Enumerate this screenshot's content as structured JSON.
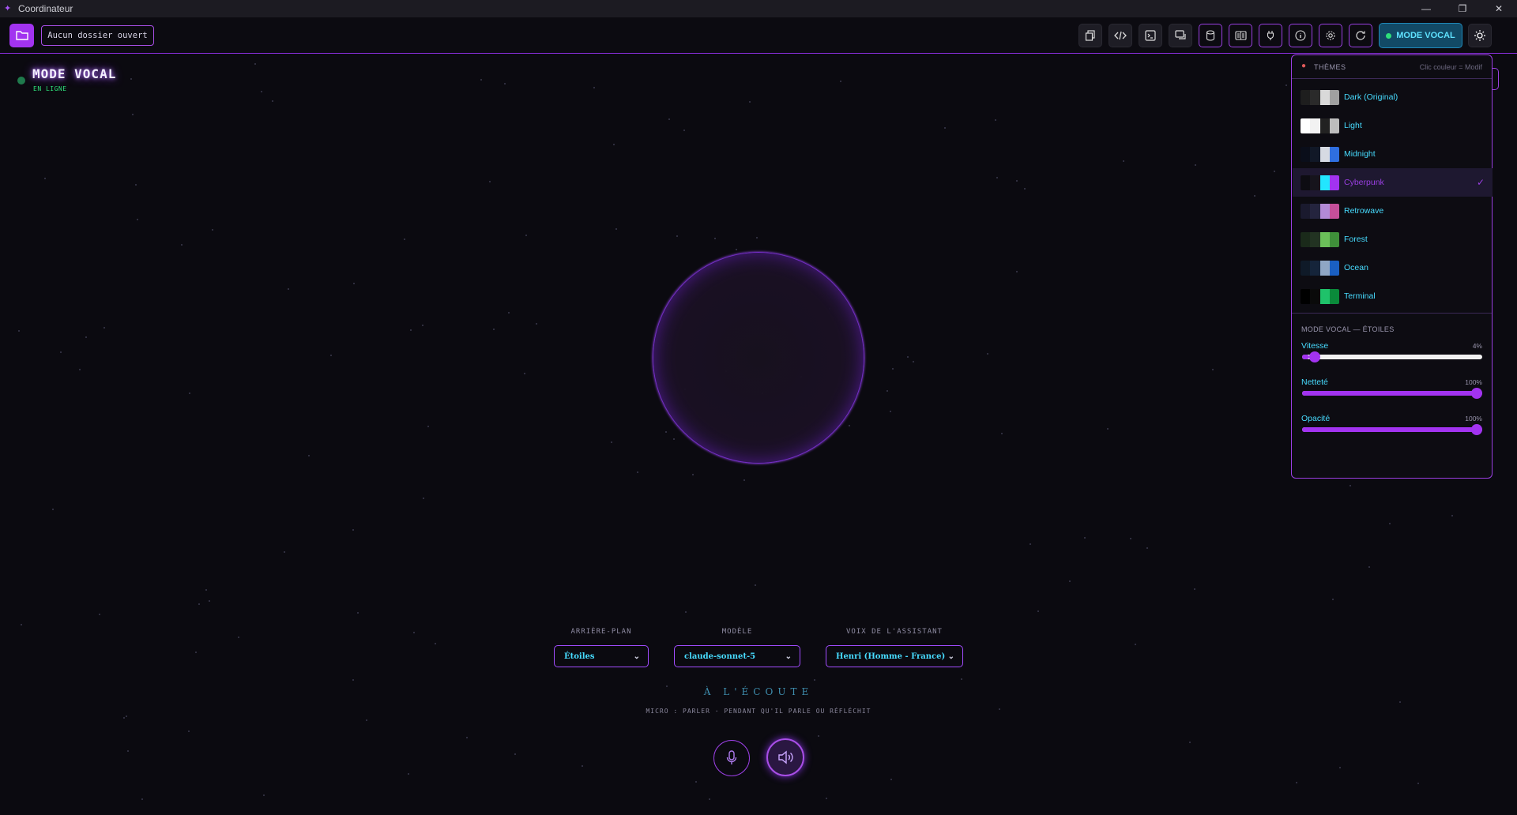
{
  "window": {
    "title": "Coordinateur"
  },
  "toolbar": {
    "folder_label": "Aucun dossier ouvert",
    "mode_vocal_label": "MODE VOCAL",
    "buttons": [
      "copy-icon",
      "code-icon",
      "terminal-icon",
      "chat-icon",
      "database-icon",
      "panel-icon",
      "plug-icon",
      "info-icon",
      "gear-icon",
      "refresh-icon",
      "sun-icon"
    ]
  },
  "voice": {
    "title": "MODE VOCAL",
    "status": "EN LIGNE",
    "listening": "À L'ÉCOUTE",
    "hint": "MICRO : PARLER · PENDANT QU'IL PARLE OU RÉFLÉCHIT",
    "selectors": [
      {
        "label": "ARRIÈRE-PLAN",
        "value": "Étoiles"
      },
      {
        "label": "MODÈLE",
        "value": "claude-sonnet-5"
      },
      {
        "label": "VOIX DE L'ASSISTANT",
        "value": "Henri (Homme - France)"
      }
    ]
  },
  "theme_panel": {
    "title": "THÈMES",
    "hint": "Clic couleur = Modif",
    "themes": [
      {
        "name": "Dark (Original)",
        "colors": [
          "#1e1e1e",
          "#2a2a2a",
          "#d9d9d9",
          "#a0a0a0"
        ],
        "active": false
      },
      {
        "name": "Light",
        "colors": [
          "#ffffff",
          "#f2f2f2",
          "#222222",
          "#bdbdbd"
        ],
        "active": false
      },
      {
        "name": "Midnight",
        "colors": [
          "#0a0e1a",
          "#111827",
          "#d6dae3",
          "#2f6fe0"
        ],
        "active": false
      },
      {
        "name": "Cyberpunk",
        "colors": [
          "#0d0c12",
          "#16141c",
          "#22e6ff",
          "#a233f0"
        ],
        "active": true
      },
      {
        "name": "Retrowave",
        "colors": [
          "#1a1a2e",
          "#24243e",
          "#b38ad6",
          "#c54f9a"
        ],
        "active": false
      },
      {
        "name": "Forest",
        "colors": [
          "#1a2a1a",
          "#223322",
          "#6bbf59",
          "#3f8f3a"
        ],
        "active": false
      },
      {
        "name": "Ocean",
        "colors": [
          "#0f1a28",
          "#15243a",
          "#8fa6c4",
          "#1a5fc2"
        ],
        "active": false
      },
      {
        "name": "Terminal",
        "colors": [
          "#000000",
          "#0a0a0a",
          "#1fc26a",
          "#0a8a3a"
        ],
        "active": false
      }
    ],
    "section": "MODE VOCAL — ÉTOILES",
    "sliders": [
      {
        "label": "Vitesse",
        "value_text": "4%",
        "value": 0.04
      },
      {
        "label": "Netteté",
        "value_text": "100%",
        "value": 1.0
      },
      {
        "label": "Opacité",
        "value_text": "100%",
        "value": 1.0
      }
    ]
  }
}
